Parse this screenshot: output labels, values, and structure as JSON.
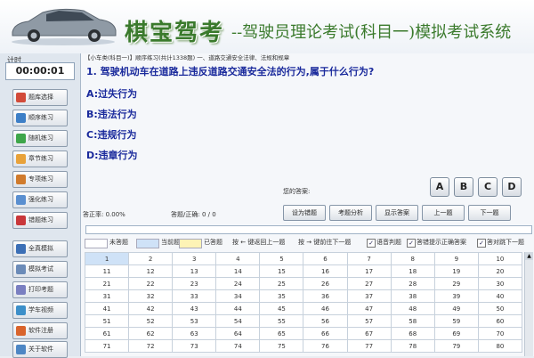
{
  "header": {
    "brand": "棋宝驾考",
    "subtitle": "--驾驶员理论考试(科目一)模拟考试系统"
  },
  "sidebar": {
    "timer_label": "计时",
    "timer_value": "00:00:01",
    "buttons": [
      {
        "label": "题库选择",
        "color": "#d24b3a"
      },
      {
        "label": "顺序练习",
        "color": "#3d7fc7"
      },
      {
        "label": "随机练习",
        "color": "#3ea64a"
      },
      {
        "label": "章节练习",
        "color": "#e8a23a"
      },
      {
        "label": "专项练习",
        "color": "#d07b2d"
      },
      {
        "label": "强化练习",
        "color": "#5a8fd0"
      },
      {
        "label": "错题练习",
        "color": "#c9373a"
      },
      {
        "label": "全真模拟",
        "color": "#3b6fb6"
      },
      {
        "label": "模拟考试",
        "color": "#6b8bb8"
      },
      {
        "label": "打印考题",
        "color": "#7a7fc1"
      },
      {
        "label": "学车视频",
        "color": "#3c8fc9"
      },
      {
        "label": "软件注册",
        "color": "#d9642c"
      },
      {
        "label": "关于软件",
        "color": "#4d86c4"
      }
    ]
  },
  "info_bar": "【小车类(科目一)】顺序练习(共计1338题)  一、道路交通安全法律、法规和规章",
  "question": {
    "text": "1. 驾驶机动车在道路上违反道路交通安全法的行为,属于什么行为?",
    "options": [
      "A:过失行为",
      "B:违法行为",
      "C:违规行为",
      "D:违章行为"
    ]
  },
  "answer_label": "您的答案:",
  "choices": [
    "A",
    "B",
    "C",
    "D"
  ],
  "stats": {
    "accuracy": "答正率: 0.00%",
    "answered": "答题/正确: 0 / 0"
  },
  "actions": [
    "设为错题",
    "考题分析",
    "显示答案",
    "上一题",
    "下一题"
  ],
  "legend": {
    "unanswered": "未答题",
    "current": "当前题",
    "answered": "已答题",
    "prev_key": "按 ← 键返回上一题",
    "next_key": "按 → 键前往下一题",
    "opt_voice": "语音判题",
    "opt_wrong": "答错提示正确答案",
    "opt_auto": "答对跳下一题",
    "colors": {
      "unanswered": "#ffffff",
      "current": "#cfe2f7",
      "answered": "#fdf3b5"
    }
  },
  "grid": {
    "rows": [
      [
        "1",
        "2",
        "3",
        "4",
        "5",
        "6",
        "7",
        "8",
        "9",
        "10"
      ],
      [
        "11",
        "12",
        "13",
        "14",
        "15",
        "16",
        "17",
        "18",
        "19",
        "20"
      ],
      [
        "21",
        "22",
        "23",
        "24",
        "25",
        "26",
        "27",
        "28",
        "29",
        "30"
      ],
      [
        "31",
        "32",
        "33",
        "34",
        "35",
        "36",
        "37",
        "38",
        "39",
        "40"
      ],
      [
        "41",
        "42",
        "43",
        "44",
        "45",
        "46",
        "47",
        "48",
        "49",
        "50"
      ],
      [
        "51",
        "52",
        "53",
        "54",
        "55",
        "56",
        "57",
        "58",
        "59",
        "60"
      ],
      [
        "61",
        "62",
        "63",
        "64",
        "65",
        "66",
        "67",
        "68",
        "69",
        "70"
      ],
      [
        "71",
        "72",
        "73",
        "74",
        "75",
        "76",
        "77",
        "78",
        "79",
        "80"
      ]
    ]
  }
}
